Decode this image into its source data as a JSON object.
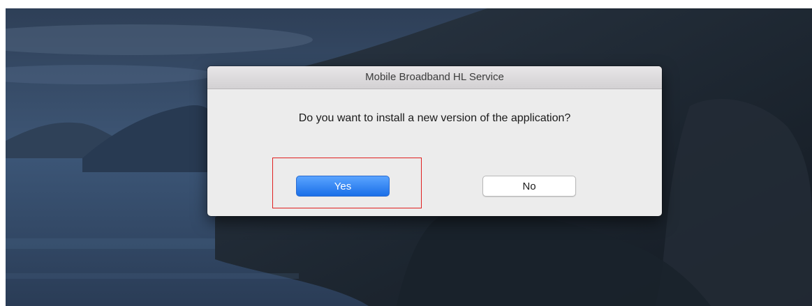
{
  "dialog": {
    "title": "Mobile Broadband HL Service",
    "message": "Do you want to install a new version of the application?",
    "yes_label": "Yes",
    "no_label": "No"
  },
  "colors": {
    "accent": "#1a6fe8",
    "highlight": "#e02020",
    "dialog_background": "#ececec"
  }
}
